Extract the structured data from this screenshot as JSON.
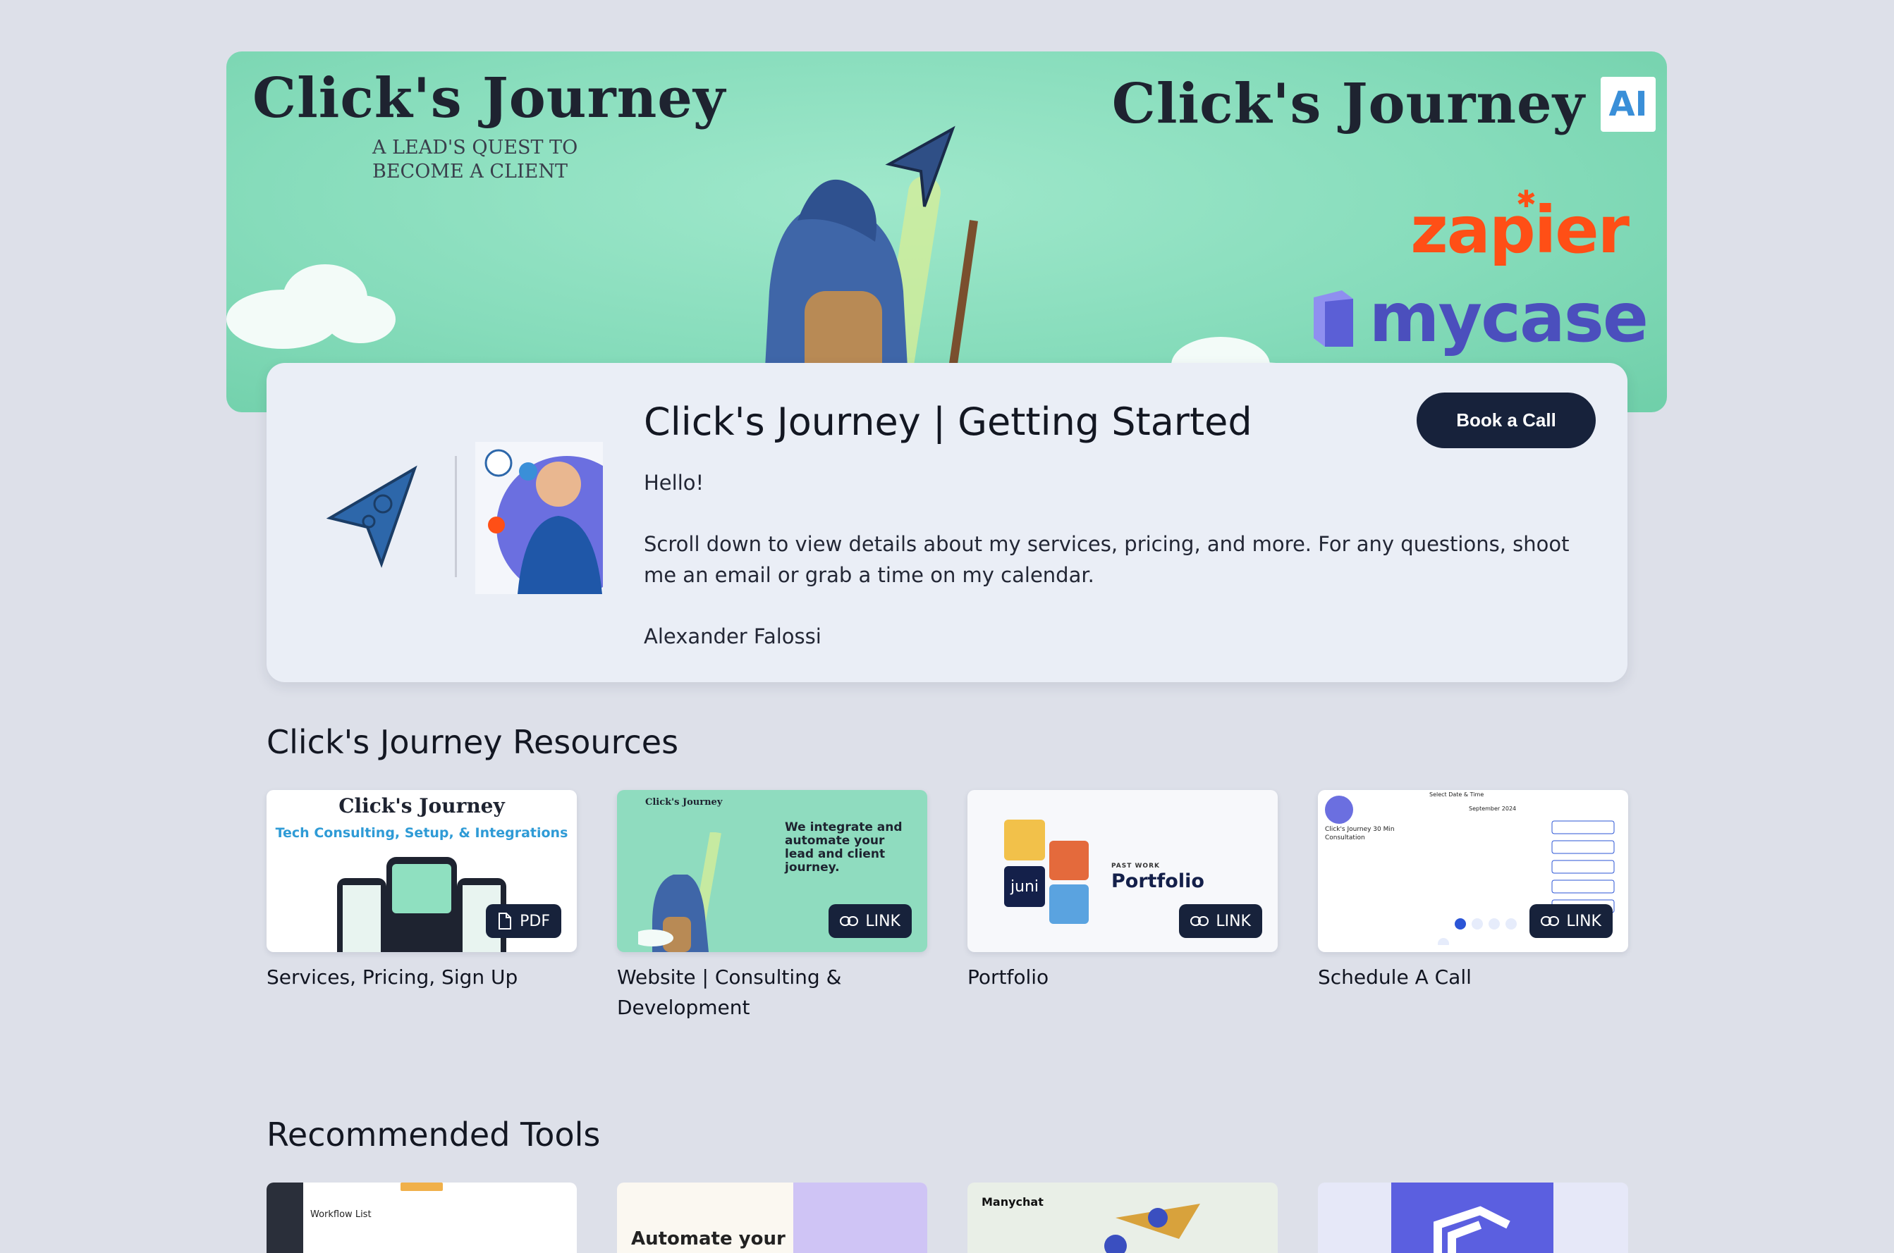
{
  "banner": {
    "brand_left_title": "Click's Journey",
    "brand_left_tagline": "A LEAD'S QUEST TO BECOME A CLIENT",
    "brand_right_title": "Click's Journey",
    "ai_badge": "AI",
    "zapier": "zapier",
    "mycase": "mycase",
    "colors": {
      "mint": "#86dcbb",
      "zapier_orange": "#ff4f16",
      "mycase_purple": "#4b4fbd"
    }
  },
  "profile": {
    "title": "Click's Journey | Getting Started",
    "greeting": "Hello!",
    "message": "Scroll down to view details about my services, pricing, and more. For any questions, shoot me an email or grab a time on my calendar.",
    "signature": "Alexander Falossi",
    "book_button": "Book a Call",
    "accent": "#17223b"
  },
  "resources": {
    "title": "Click's Journey Resources",
    "items": [
      {
        "label": "Services, Pricing, Sign Up",
        "badge": "PDF",
        "badge_icon": "document-icon",
        "thumb_heading": "Tech Consulting, Setup, & Integrations",
        "thumb_brand": "Click's Journey"
      },
      {
        "label": "Website | Consulting & Development",
        "badge": "LINK",
        "badge_icon": "link-icon",
        "thumb_heading": "We integrate and automate your lead and client journey.",
        "thumb_brand": "Click's Journey"
      },
      {
        "label": "Portfolio",
        "badge": "LINK",
        "badge_icon": "link-icon",
        "thumb_kicker": "PAST WORK",
        "thumb_heading": "Portfolio",
        "thumb_tile": "juni"
      },
      {
        "label": "Schedule A Call",
        "badge": "LINK",
        "badge_icon": "link-icon",
        "thumb_heading": "Select Date & Time",
        "thumb_month": "September 2024",
        "thumb_event": "Click's Journey 30 Min Consultation"
      }
    ]
  },
  "tools": {
    "title": "Recommended Tools",
    "items": [
      {
        "thumb_heading": "Workflow List"
      },
      {
        "thumb_heading": "Automate your"
      },
      {
        "thumb_heading": "Manychat"
      },
      {
        "thumb_heading": ""
      }
    ]
  }
}
